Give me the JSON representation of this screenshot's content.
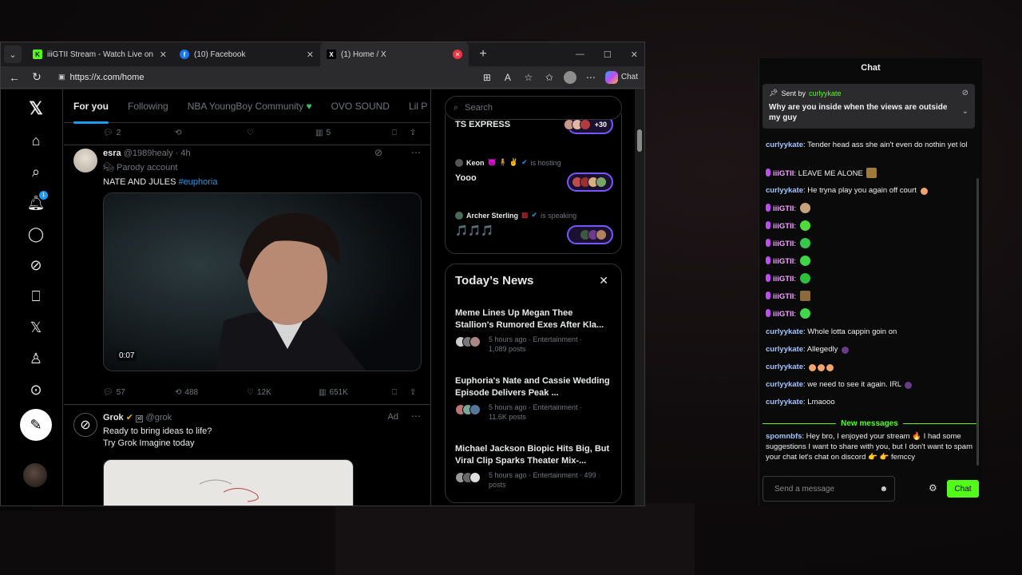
{
  "browser": {
    "tabs": [
      {
        "title": "iiiGTII Stream - Watch Live on Kick",
        "icon": "kick"
      },
      {
        "title": "(10) Facebook",
        "icon": "facebook"
      },
      {
        "title": "(1) Home / X",
        "icon": "x",
        "active": true
      }
    ],
    "url": "https://x.com/home",
    "copilot_label": "Chat"
  },
  "x": {
    "tabs": [
      "For you",
      "Following",
      "NBA YoungBoy Community",
      "OVO SOUND",
      "Lil P"
    ],
    "prev_actions": {
      "replies": "2",
      "views": "5"
    },
    "notifications_badge": "1",
    "tweets": [
      {
        "name": "esra",
        "handle": "@1989healy",
        "time": "4h",
        "label": "Parody account",
        "text": "NATE AND JULES",
        "hashtag": "#euphoria",
        "video_time": "0:07",
        "replies": "57",
        "reposts": "488",
        "likes": "12K",
        "views": "651K"
      },
      {
        "name": "Grok",
        "handle": "@grok",
        "ad": "Ad",
        "line1": "Ready to bring ideas to life?",
        "line2": "Try Grok Imagine today"
      }
    ],
    "search_placeholder": "Search",
    "spaces": [
      {
        "title": "TS EXPRESS",
        "pill": "+30"
      },
      {
        "host": "Keon",
        "status": "is hosting",
        "title": "Yooo"
      },
      {
        "host": "Archer Sterling",
        "status": "is speaking",
        "title": "🎵🎵🎵"
      }
    ],
    "news": {
      "title": "Today’s News",
      "items": [
        {
          "headline": "Meme Lines Up Megan Thee Stallion's Rumored Exes After Kla...",
          "meta1": "5 hours ago · Entertainment ·",
          "meta2": "1,089 posts"
        },
        {
          "headline": "Euphoria's Nate and Cassie Wedding Episode Delivers Peak ...",
          "meta1": "5 hours ago · Entertainment ·",
          "meta2": "11.6K posts"
        },
        {
          "headline": "Michael Jackson Biopic Hits Big, But Viral Clip Sparks Theater Mix-...",
          "meta1": "5 hours ago · Entertainment · 499",
          "meta2": "posts"
        }
      ]
    }
  },
  "chat": {
    "title": "Chat",
    "pinned": {
      "sent_by": "Sent by",
      "user": "curlyykate",
      "message": "Why are you inside when the views are outside my guy"
    },
    "messages": [
      {
        "user": "curlyykate",
        "text": "Tender head ass she ain't even do nothin yet lol",
        "color": "blue"
      },
      {
        "user": "iiiGTII",
        "text": "LEAVE ME ALONE",
        "color": "pink"
      },
      {
        "user": "curlyykate",
        "text": "He tryna play you again off court",
        "color": "blue"
      },
      {
        "user": "iiiGTII",
        "text": "",
        "color": "pink"
      },
      {
        "user": "iiiGTII",
        "text": "",
        "color": "pink"
      },
      {
        "user": "iiiGTII",
        "text": "",
        "color": "pink"
      },
      {
        "user": "iiiGTII",
        "text": "",
        "color": "pink"
      },
      {
        "user": "iiiGTII",
        "text": "",
        "color": "pink"
      },
      {
        "user": "iiiGTII",
        "text": "",
        "color": "pink"
      },
      {
        "user": "iiiGTII",
        "text": "",
        "color": "pink"
      },
      {
        "user": "curlyykate",
        "text": "Whole lotta cappin goin on",
        "color": "blue"
      },
      {
        "user": "curlyykate",
        "text": "Allegedly",
        "color": "blue"
      },
      {
        "user": "curlyykate",
        "text": "",
        "color": "blue"
      },
      {
        "user": "curlyykate",
        "text": "we need to see it again. IRL",
        "color": "blue"
      },
      {
        "user": "curlyykate",
        "text": "Lmaooo",
        "color": "blue"
      }
    ],
    "new_messages_label": "New messages",
    "last": {
      "user": "spomnbfs",
      "text": "Hey bro, I enjoyed your stream 🔥 I had some suggestions I want to share with you, but I don't want to spam your chat let's chat on discord 👉 👉 femccy"
    },
    "input_placeholder": "Send a message",
    "send_label": "Chat"
  }
}
